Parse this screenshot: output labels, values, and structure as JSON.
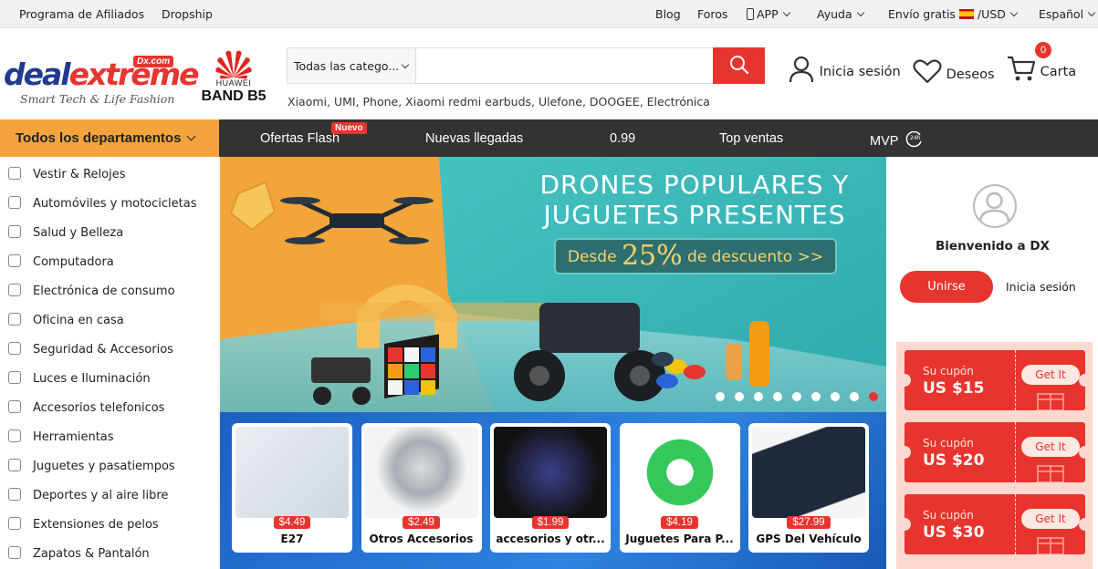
{
  "topbar": {
    "left": [
      "Programa de Afiliados",
      "Dropship"
    ],
    "blog": "Blog",
    "foros": "Foros",
    "app": "APP",
    "ayuda": "Ayuda",
    "envio": "Envío gratis",
    "currency": "/USD",
    "language": "Español"
  },
  "logo": {
    "deal": "deal",
    "extreme": "extreme",
    "dxcom": "Dx.com",
    "tagline": "Smart Tech & Life Fashion"
  },
  "huawei": {
    "brand": "HUAWEI",
    "product": "BAND B5"
  },
  "search": {
    "category": "Todas las catego...",
    "placeholder": "",
    "hotwords": "Xiaomi, UMI, Phone, Xiaomi redmi earbuds, Ulefone, DOOGEE, Electrónica"
  },
  "header": {
    "login": "Inicia sesión",
    "wishlist": "Deseos",
    "cart": "Carta",
    "cart_count": "0"
  },
  "nav": {
    "all_departments": "Todos los departamentos",
    "links": [
      "Ofertas Flash",
      "Nuevas llegadas",
      "0.99",
      "Top ventas",
      "MVP"
    ],
    "badge": "Nuevo"
  },
  "sidebar": {
    "items": [
      {
        "label": "Vestir & Relojes",
        "icon": "shirt-icon"
      },
      {
        "label": "Automóviles y motocicletas",
        "icon": "car-icon"
      },
      {
        "label": "Salud y Belleza",
        "icon": "health-icon"
      },
      {
        "label": "Computadora",
        "icon": "monitor-icon"
      },
      {
        "label": "Electrónica de consumo",
        "icon": "headphones-icon"
      },
      {
        "label": "Oficina en casa",
        "icon": "sofa-icon"
      },
      {
        "label": "Seguridad & Accesorios",
        "icon": "tag-icon"
      },
      {
        "label": "Luces e Iluminación",
        "icon": "bulb-icon"
      },
      {
        "label": "Accesorios telefonicos",
        "icon": "phone-icon"
      },
      {
        "label": "Herramientas",
        "icon": "toolbox-icon"
      },
      {
        "label": "Juguetes y pasatiempos",
        "icon": "toy-icon"
      },
      {
        "label": "Deportes y al aire libre",
        "icon": "runner-icon"
      },
      {
        "label": "Extensiones de pelos",
        "icon": "hair-icon"
      },
      {
        "label": "Zapatos & Pantalón",
        "icon": "shoe-icon"
      }
    ]
  },
  "banner": {
    "title_line1": "DRONES POPULARES Y",
    "title_line2": "JUGUETES PRESENTES",
    "promo_prefix": "Desde ",
    "promo_big": "25%",
    "promo_suffix": " de descuento >>",
    "dots_count": 9,
    "active_dot": 9
  },
  "products": [
    {
      "price": "$4.49",
      "name": "E27"
    },
    {
      "price": "$2.49",
      "name": "Otros Accesorios"
    },
    {
      "price": "$1.99",
      "name": "accesorios y otr..."
    },
    {
      "price": "$4.19",
      "name": "Juguetes Para P..."
    },
    {
      "price": "$27.99",
      "name": "GPS Del Vehículo"
    }
  ],
  "right_panel": {
    "welcome": "Bienvenido a DX",
    "join": "Unirse",
    "login": "Inicia sesión",
    "coupons": [
      {
        "label": "Su cupón",
        "value": "US $15",
        "button": "Get It"
      },
      {
        "label": "Su cupón",
        "value": "US $20",
        "button": "Get It"
      },
      {
        "label": "Su cupón",
        "value": "US $30",
        "button": "Get It"
      }
    ]
  },
  "colors": {
    "accent": "#e8342e",
    "nav_bg": "#333333",
    "departments_bg": "#f5a33d"
  }
}
